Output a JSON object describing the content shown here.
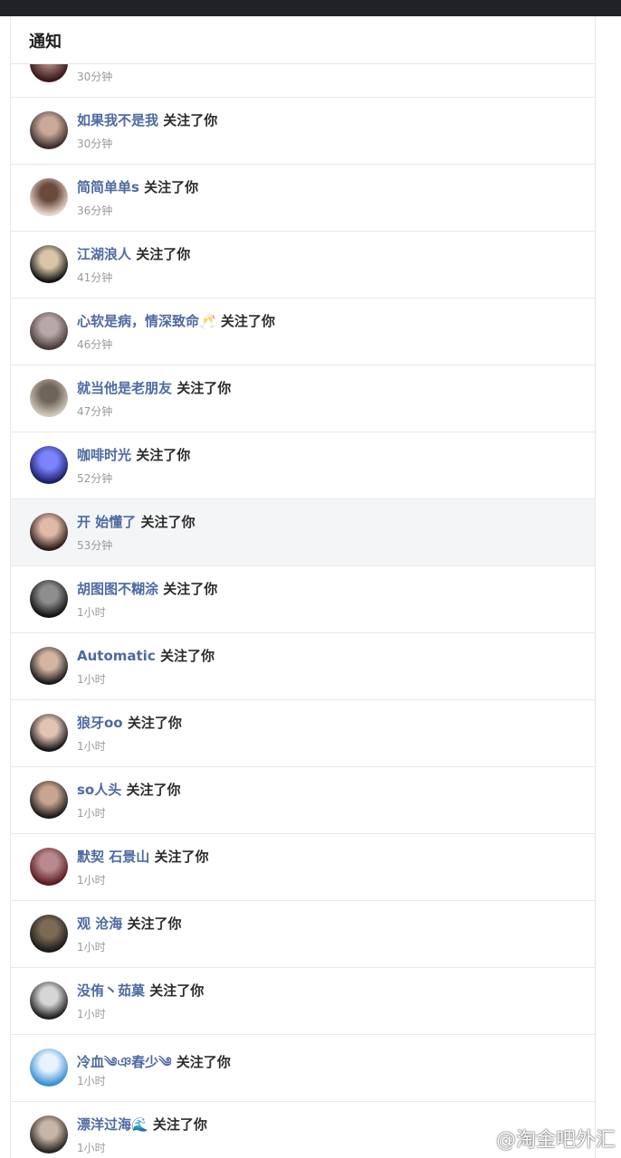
{
  "header": {
    "title": "通知"
  },
  "action_text": "关注了你",
  "first_partial": {
    "time": "30分钟"
  },
  "items": [
    {
      "name": "如果我不是我",
      "time": "30分钟",
      "colors": [
        "#3b2d2a",
        "#c9a99a"
      ]
    },
    {
      "name": "简简单单s",
      "time": "36分钟",
      "colors": [
        "#e8d6cc",
        "#6b4a3e"
      ]
    },
    {
      "name": "江湖浪人",
      "time": "41分钟",
      "colors": [
        "#111111",
        "#d9c6a8"
      ]
    },
    {
      "name": "心软是病，情深致命🥂",
      "time": "46分钟",
      "colors": [
        "#4a3a3a",
        "#b9a8a8"
      ]
    },
    {
      "name": "就当他是老朋友",
      "time": "47分钟",
      "colors": [
        "#cfc7b8",
        "#6e6458"
      ]
    },
    {
      "name": "咖啡时光",
      "time": "52分钟",
      "colors": [
        "#1b1f66",
        "#7b83ff"
      ]
    },
    {
      "name": "开 始懂了",
      "time": "53分钟",
      "colors": [
        "#2a1c1a",
        "#e2b9a8"
      ]
    },
    {
      "name": "胡图图不糊涂",
      "time": "1小时",
      "colors": [
        "#121212",
        "#8e8e8e"
      ]
    },
    {
      "name": "Automatic",
      "time": "1小时",
      "colors": [
        "#1a1a1a",
        "#d3b5a1"
      ]
    },
    {
      "name": "狼牙oo",
      "time": "1小时",
      "colors": [
        "#161616",
        "#e2c4b6"
      ]
    },
    {
      "name": "so人头",
      "time": "1小时",
      "colors": [
        "#1c1c1c",
        "#c9a48e"
      ]
    },
    {
      "name": "默契 石景山",
      "time": "1小时",
      "colors": [
        "#5a1a22",
        "#b88a8f"
      ]
    },
    {
      "name": "观 沧海",
      "time": "1小时",
      "colors": [
        "#1a1a1a",
        "#7d6a55"
      ]
    },
    {
      "name": "没侑丶茹菓",
      "time": "1小时",
      "colors": [
        "#202020",
        "#d6d6d6"
      ]
    },
    {
      "name": "冷血༄ঞ春少༄",
      "time": "1小时",
      "colors": [
        "#3a8fd1",
        "#e9f3ff"
      ]
    },
    {
      "name": "漂洋过海🌊",
      "time": "1小时",
      "colors": [
        "#2a2420",
        "#c7b6a7"
      ]
    }
  ],
  "watermark": "@淘金吧外汇"
}
